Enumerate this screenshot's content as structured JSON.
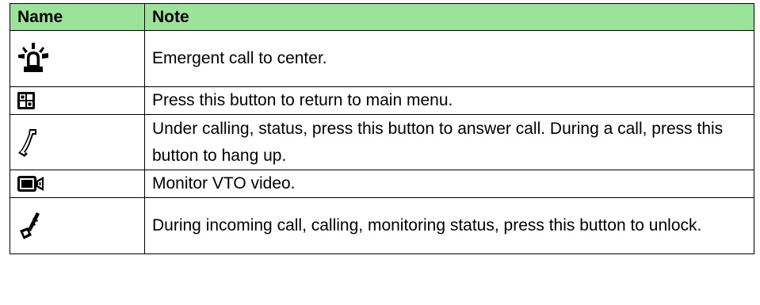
{
  "table": {
    "headers": {
      "name": "Name",
      "note": "Note"
    },
    "rows": [
      {
        "icon": "emergency-siren-icon",
        "note": "Emergent call to center."
      },
      {
        "icon": "main-menu-grid-icon",
        "note": "Press this button to return to main menu."
      },
      {
        "icon": "phone-handset-icon",
        "note": "Under calling, status, press this button to answer call. During a call, press this button to hang up."
      },
      {
        "icon": "video-camera-icon",
        "note": "Monitor VTO video."
      },
      {
        "icon": "unlock-key-icon",
        "note": "During incoming call, calling, monitoring status, press this button to unlock."
      }
    ]
  },
  "colors": {
    "header_background": "#9be39b",
    "border": "#000000",
    "text": "#000000"
  }
}
